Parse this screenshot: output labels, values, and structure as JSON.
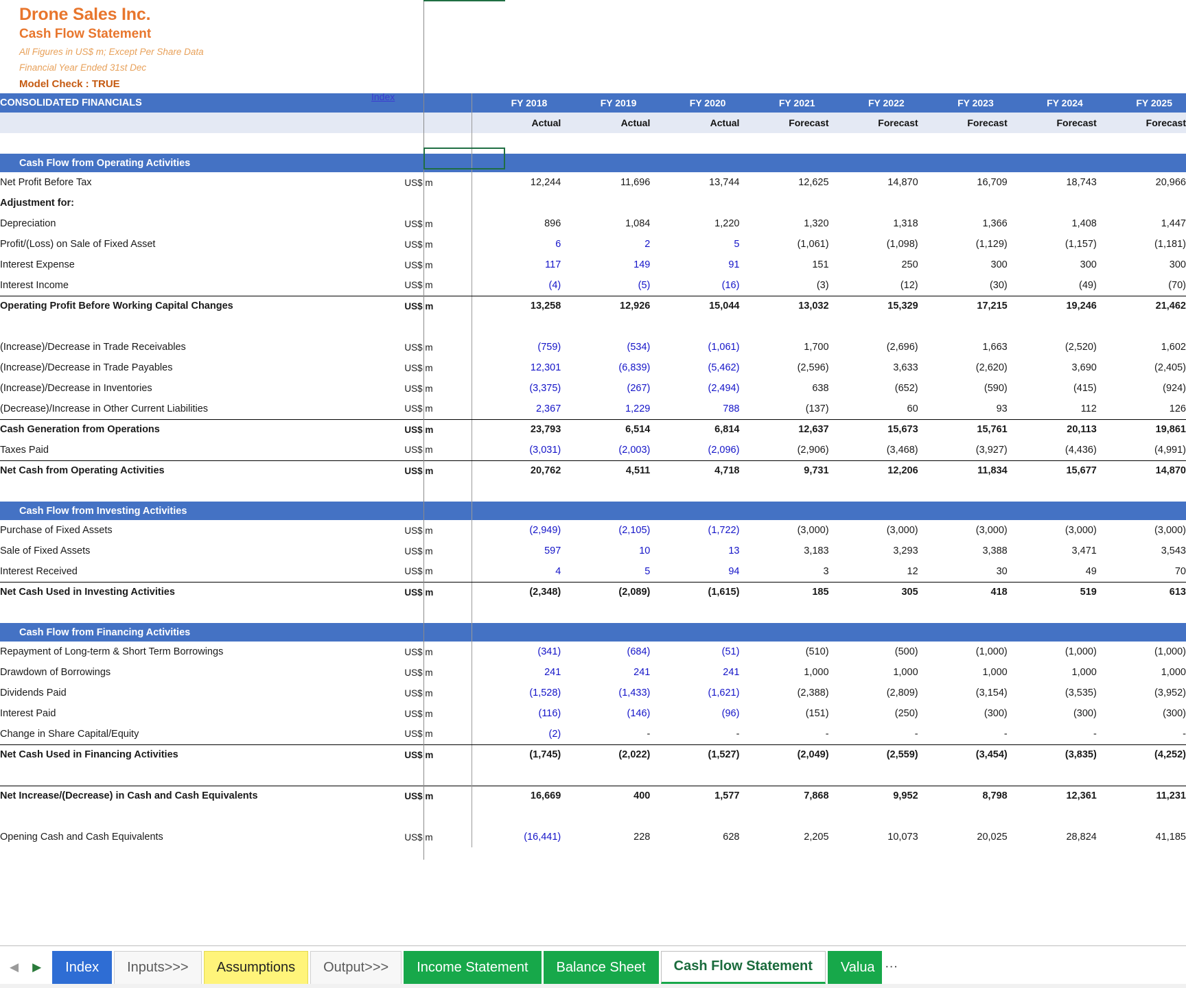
{
  "header": {
    "company": "Drone Sales Inc.",
    "statement": "Cash Flow Statement",
    "note1": "All Figures in US$ m; Except Per Share Data",
    "note2": "Financial Year Ended 31st Dec",
    "model_check": "Model Check : TRUE",
    "index_link": "Index",
    "consolidated_label": "CONSOLIDATED FINANCIALS",
    "accent_orange": "#E8762D",
    "accent_blue": "#4472C4",
    "input_blue": "#1414C8"
  },
  "columns": {
    "years": [
      "FY 2018",
      "FY 2019",
      "FY 2020",
      "FY 2021",
      "FY 2022",
      "FY 2023",
      "FY 2024",
      "FY 2025"
    ],
    "kinds": [
      "Actual",
      "Actual",
      "Actual",
      "Forecast",
      "Forecast",
      "Forecast",
      "Forecast",
      "Forecast"
    ]
  },
  "unit_label": "US$ m",
  "sections": [
    {
      "band": "Cash Flow from Operating Activities",
      "rows": [
        {
          "label": "Net Profit Before Tax",
          "unit": "US$ m",
          "values": [
            "12,244",
            "11,696",
            "13,744",
            "12,625",
            "14,870",
            "16,709",
            "18,743",
            "20,966"
          ],
          "blue_cols": [],
          "bold": false
        },
        {
          "label": "Adjustment for:",
          "unit": "",
          "values": [
            "",
            "",
            "",
            "",
            "",
            "",
            "",
            ""
          ],
          "blue_cols": [],
          "bold": true
        },
        {
          "label": "Depreciation",
          "unit": "US$ m",
          "values": [
            "896",
            "1,084",
            "1,220",
            "1,320",
            "1,318",
            "1,366",
            "1,408",
            "1,447"
          ],
          "blue_cols": [],
          "bold": false
        },
        {
          "label": "Profit/(Loss) on Sale of Fixed Asset",
          "unit": "US$ m",
          "values": [
            "6",
            "2",
            "5",
            "(1,061)",
            "(1,098)",
            "(1,129)",
            "(1,157)",
            "(1,181)"
          ],
          "blue_cols": [
            0,
            1,
            2
          ],
          "bold": false
        },
        {
          "label": "Interest Expense",
          "unit": "US$ m",
          "values": [
            "117",
            "149",
            "91",
            "151",
            "250",
            "300",
            "300",
            "300"
          ],
          "blue_cols": [
            0,
            1,
            2
          ],
          "bold": false
        },
        {
          "label": "Interest Income",
          "unit": "US$ m",
          "values": [
            "(4)",
            "(5)",
            "(16)",
            "(3)",
            "(12)",
            "(30)",
            "(49)",
            "(70)"
          ],
          "blue_cols": [
            0,
            1,
            2
          ],
          "bold": false,
          "rule_below": true
        },
        {
          "label": "Operating Profit Before Working Capital Changes",
          "unit": "US$ m",
          "values": [
            "13,258",
            "12,926",
            "15,044",
            "13,032",
            "15,329",
            "17,215",
            "19,246",
            "21,462"
          ],
          "blue_cols": [],
          "bold": true
        },
        {
          "label": "",
          "unit": "",
          "values": [
            "",
            "",
            "",
            "",
            "",
            "",
            "",
            ""
          ],
          "blue_cols": [],
          "bold": false,
          "spacer": true
        },
        {
          "label": "(Increase)/Decrease in Trade Receivables",
          "unit": "US$ m",
          "values": [
            "(759)",
            "(534)",
            "(1,061)",
            "1,700",
            "(2,696)",
            "1,663",
            "(2,520)",
            "1,602"
          ],
          "blue_cols": [
            0,
            1,
            2
          ],
          "bold": false
        },
        {
          "label": "(Increase)/Decrease in Trade Payables",
          "unit": "US$ m",
          "values": [
            "12,301",
            "(6,839)",
            "(5,462)",
            "(2,596)",
            "3,633",
            "(2,620)",
            "3,690",
            "(2,405)"
          ],
          "blue_cols": [
            0,
            1,
            2
          ],
          "bold": false
        },
        {
          "label": "(Increase)/Decrease in Inventories",
          "unit": "US$ m",
          "values": [
            "(3,375)",
            "(267)",
            "(2,494)",
            "638",
            "(652)",
            "(590)",
            "(415)",
            "(924)"
          ],
          "blue_cols": [
            0,
            1,
            2
          ],
          "bold": false
        },
        {
          "label": "(Decrease)/Increase in Other Current Liabilities",
          "unit": "US$ m",
          "values": [
            "2,367",
            "1,229",
            "788",
            "(137)",
            "60",
            "93",
            "112",
            "126"
          ],
          "blue_cols": [
            0,
            1,
            2
          ],
          "bold": false,
          "rule_below": true
        },
        {
          "label": "Cash Generation from Operations",
          "unit": "US$ m",
          "values": [
            "23,793",
            "6,514",
            "6,814",
            "12,637",
            "15,673",
            "15,761",
            "20,113",
            "19,861"
          ],
          "blue_cols": [],
          "bold": true
        },
        {
          "label": "Taxes Paid",
          "unit": "US$ m",
          "values": [
            "(3,031)",
            "(2,003)",
            "(2,096)",
            "(2,906)",
            "(3,468)",
            "(3,927)",
            "(4,436)",
            "(4,991)"
          ],
          "blue_cols": [
            0,
            1,
            2
          ],
          "bold": false,
          "rule_below": true
        },
        {
          "label": "Net Cash from Operating Activities",
          "unit": "US$ m",
          "values": [
            "20,762",
            "4,511",
            "4,718",
            "9,731",
            "12,206",
            "11,834",
            "15,677",
            "14,870"
          ],
          "blue_cols": [],
          "bold": true
        }
      ]
    },
    {
      "band": "Cash Flow from Investing Activities",
      "rows": [
        {
          "label": "Purchase of Fixed Assets",
          "unit": "US$ m",
          "values": [
            "(2,949)",
            "(2,105)",
            "(1,722)",
            "(3,000)",
            "(3,000)",
            "(3,000)",
            "(3,000)",
            "(3,000)"
          ],
          "blue_cols": [
            0,
            1,
            2
          ],
          "bold": false
        },
        {
          "label": "Sale of Fixed Assets",
          "unit": "US$ m",
          "values": [
            "597",
            "10",
            "13",
            "3,183",
            "3,293",
            "3,388",
            "3,471",
            "3,543"
          ],
          "blue_cols": [
            0,
            1,
            2
          ],
          "bold": false
        },
        {
          "label": "Interest Received",
          "unit": "US$ m",
          "values": [
            "4",
            "5",
            "94",
            "3",
            "12",
            "30",
            "49",
            "70"
          ],
          "blue_cols": [
            0,
            1,
            2
          ],
          "bold": false,
          "rule_below": true
        },
        {
          "label": "Net Cash Used in Investing Activities",
          "unit": "US$ m",
          "values": [
            "(2,348)",
            "(2,089)",
            "(1,615)",
            "185",
            "305",
            "418",
            "519",
            "613"
          ],
          "blue_cols": [],
          "bold": true
        }
      ]
    },
    {
      "band": "Cash Flow from Financing Activities",
      "rows": [
        {
          "label": "Repayment of Long-term & Short Term Borrowings",
          "unit": "US$ m",
          "values": [
            "(341)",
            "(684)",
            "(51)",
            "(510)",
            "(500)",
            "(1,000)",
            "(1,000)",
            "(1,000)"
          ],
          "blue_cols": [
            0,
            1,
            2
          ],
          "bold": false
        },
        {
          "label": "Drawdown of Borrowings",
          "unit": "US$ m",
          "values": [
            "241",
            "241",
            "241",
            "1,000",
            "1,000",
            "1,000",
            "1,000",
            "1,000"
          ],
          "blue_cols": [
            0,
            1,
            2
          ],
          "bold": false
        },
        {
          "label": "Dividends Paid",
          "unit": "US$ m",
          "values": [
            "(1,528)",
            "(1,433)",
            "(1,621)",
            "(2,388)",
            "(2,809)",
            "(3,154)",
            "(3,535)",
            "(3,952)"
          ],
          "blue_cols": [
            0,
            1,
            2
          ],
          "bold": false
        },
        {
          "label": "Interest Paid",
          "unit": "US$ m",
          "values": [
            "(116)",
            "(146)",
            "(96)",
            "(151)",
            "(250)",
            "(300)",
            "(300)",
            "(300)"
          ],
          "blue_cols": [
            0,
            1,
            2
          ],
          "bold": false
        },
        {
          "label": "Change in Share Capital/Equity",
          "unit": "US$ m",
          "values": [
            "(2)",
            "-",
            "-",
            "-",
            "-",
            "-",
            "-",
            "-"
          ],
          "blue_cols": [
            0
          ],
          "bold": false,
          "rule_below": true
        },
        {
          "label": "Net Cash Used in Financing Activities",
          "unit": "US$ m",
          "values": [
            "(1,745)",
            "(2,022)",
            "(1,527)",
            "(2,049)",
            "(2,559)",
            "(3,454)",
            "(3,835)",
            "(4,252)"
          ],
          "blue_cols": [],
          "bold": true
        }
      ]
    },
    {
      "band": "",
      "rows": [
        {
          "label": "Net Increase/(Decrease) in Cash and Cash Equivalents",
          "unit": "US$ m",
          "values": [
            "16,669",
            "400",
            "1,577",
            "7,868",
            "9,952",
            "8,798",
            "12,361",
            "11,231"
          ],
          "blue_cols": [],
          "bold": true,
          "rule_above": true
        },
        {
          "label": "",
          "unit": "",
          "values": [
            "",
            "",
            "",
            "",
            "",
            "",
            "",
            ""
          ],
          "blue_cols": [],
          "bold": false,
          "spacer": true
        },
        {
          "label": "Opening Cash and Cash Equivalents",
          "unit": "US$ m",
          "values": [
            "(16,441)",
            "228",
            "628",
            "2,205",
            "10,073",
            "20,025",
            "28,824",
            "41,185"
          ],
          "blue_cols": [
            0
          ],
          "bold": false
        }
      ]
    }
  ],
  "tabbar": {
    "nav_prev": "◀",
    "nav_next": "▶",
    "tabs": [
      {
        "label": "Index",
        "style": "blue"
      },
      {
        "label": "Inputs>>>",
        "style": "plain"
      },
      {
        "label": "Assumptions",
        "style": "yellow"
      },
      {
        "label": "Output>>>",
        "style": "plain"
      },
      {
        "label": "Income Statement",
        "style": "green"
      },
      {
        "label": "Balance Sheet",
        "style": "green"
      },
      {
        "label": "Cash Flow Statement",
        "style": "active"
      },
      {
        "label": "Valua",
        "style": "green"
      }
    ],
    "overflow": "…"
  }
}
